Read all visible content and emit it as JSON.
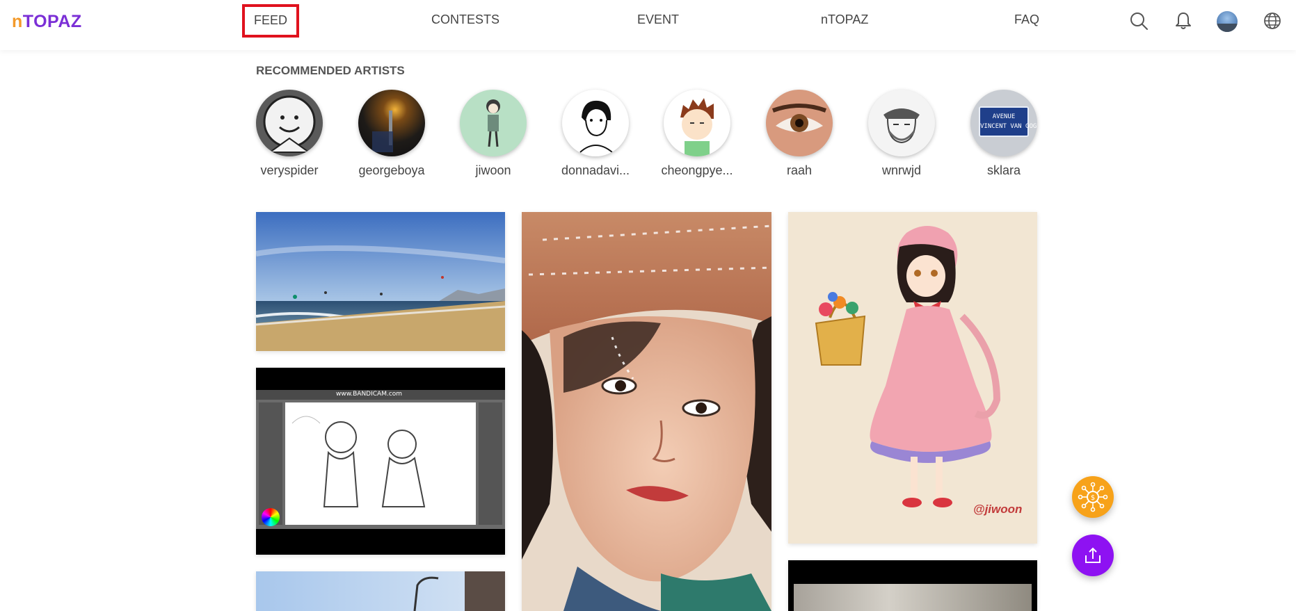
{
  "logo": "nTOPAZ",
  "nav": [
    "FEED",
    "CONTESTS",
    "EVENT",
    "nTOPAZ",
    "FAQ"
  ],
  "section_title": "RECOMMENDED ARTISTS",
  "artists": [
    {
      "name": "veryspider"
    },
    {
      "name": "georgeboya"
    },
    {
      "name": "jiwoon"
    },
    {
      "name": "donnadavi..."
    },
    {
      "name": "cheongpye..."
    },
    {
      "name": "raah"
    },
    {
      "name": "wnrwjd"
    },
    {
      "name": "sklara"
    }
  ],
  "sign_text": "AVENUE\nVINCENT VAN GOGH",
  "video_watermark": "www.BANDICAM.com",
  "art_signature": "@jiwoon",
  "colors": {
    "accent": "#7b2fd6",
    "fab_orange": "#f7a21a",
    "fab_purple": "#8e12f2",
    "active_border": "#e0121e"
  }
}
